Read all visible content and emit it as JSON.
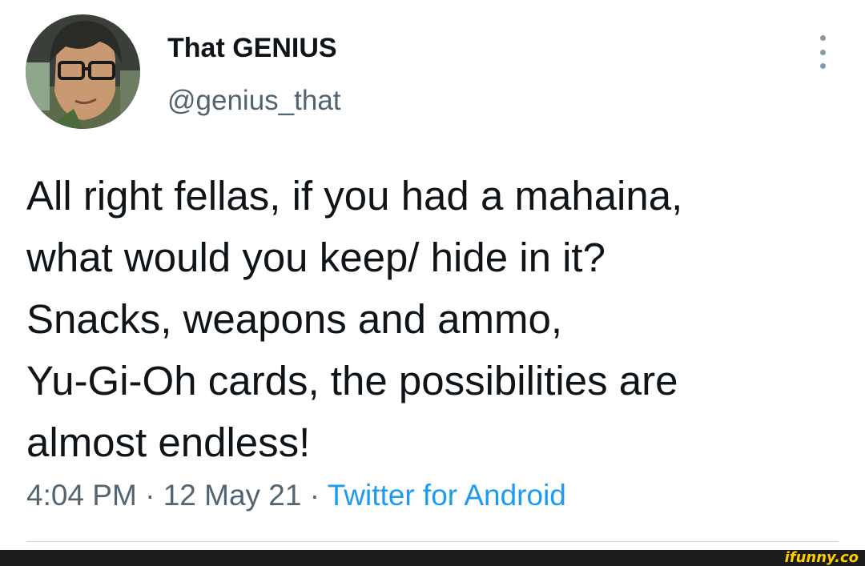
{
  "tweet": {
    "display_name": "That GENIUS",
    "handle": "@genius_that",
    "avatar_icon": "profile-avatar",
    "more_icon": "vertical-ellipsis-icon",
    "text_lines": [
      "All right fellas, if you had a mahaina,",
      "what would you keep/ hide in it?",
      "Snacks, weapons and ammo,",
      "Yu-Gi-Oh cards, the possibilities are",
      "almost endless!"
    ],
    "time": "4:04 PM",
    "separator": " · ",
    "date": "12 May 21",
    "source": "Twitter for Android"
  },
  "watermark": "ifunny.co",
  "colors": {
    "text": "#0f1419",
    "secondary": "#536471",
    "link": "#1d9bf0",
    "watermark": "#ffcc00",
    "watermark_bar": "#1c1c1c"
  }
}
